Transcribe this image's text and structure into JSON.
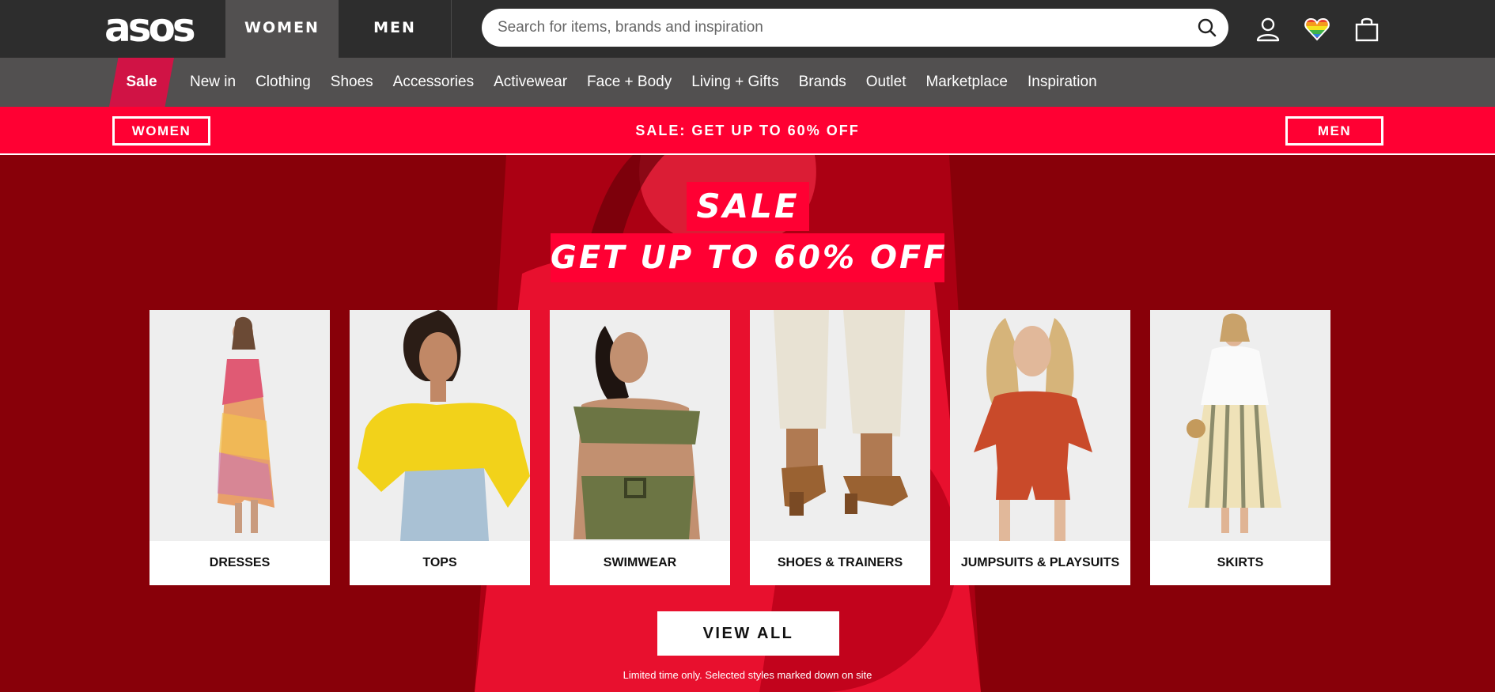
{
  "brand": {
    "logo": "asos"
  },
  "gender_tabs": [
    {
      "label": "WOMEN"
    },
    {
      "label": "MEN"
    }
  ],
  "search": {
    "placeholder": "Search for items, brands and inspiration",
    "value": ""
  },
  "header_icons": [
    "account-icon",
    "saved-items-heart-icon",
    "bag-icon"
  ],
  "nav": {
    "sale_label": "Sale",
    "items": [
      "New in",
      "Clothing",
      "Shoes",
      "Accessories",
      "Activewear",
      "Face + Body",
      "Living + Gifts",
      "Brands",
      "Outlet",
      "Marketplace",
      "Inspiration"
    ]
  },
  "promo": {
    "women_label": "WOMEN",
    "text": "SALE: GET UP TO 60% OFF",
    "men_label": "MEN"
  },
  "hero": {
    "headline": "SALE",
    "subheadline": "GET UP TO 60% OFF",
    "categories": [
      {
        "label": "DRESSES"
      },
      {
        "label": "TOPS"
      },
      {
        "label": "SWIMWEAR"
      },
      {
        "label": "SHOES & TRAINERS"
      },
      {
        "label": "JUMPSUITS & PLAYSUITS"
      },
      {
        "label": "SKIRTS"
      }
    ],
    "cta_label": "VIEW ALL",
    "disclaimer": "Limited time only. Selected styles marked down on site"
  },
  "colors": {
    "topbar": "#2d2d2d",
    "nav": "#525050",
    "sale_accent": "#d01345",
    "promo": "#ff0033",
    "hero_bg": "#880009"
  }
}
